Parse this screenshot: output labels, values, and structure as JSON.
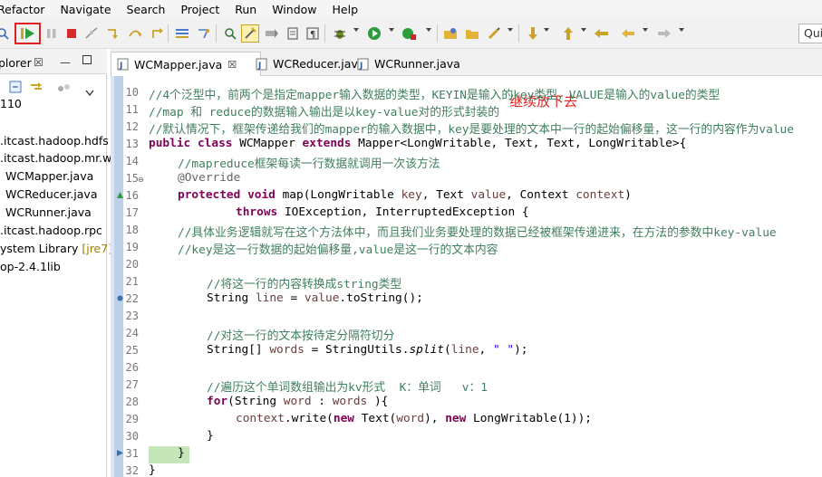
{
  "menubar": [
    "Refactor",
    "Navigate",
    "Search",
    "Project",
    "Run",
    "Window",
    "Help"
  ],
  "toolbar": {
    "icons": [
      "link-icon",
      "resume-icon",
      "suspend-icon",
      "terminate-icon",
      "disconnect-icon",
      "step-into-icon",
      "step-over-icon",
      "step-return-icon",
      "drop-to-frame-icon",
      "use-step-filters-icon",
      "new-icon",
      "pin-icon",
      "highlight-icon",
      "toggle-icon",
      "block-icon",
      "paragraph-icon",
      "debug-icon",
      "run-icon",
      "external-tools-icon",
      "open-type-icon",
      "open-folder-icon",
      "edit-icon",
      "annotation-next-icon",
      "annotation-prev-icon",
      "last-edit-icon",
      "back-icon",
      "forward-icon"
    ],
    "quick_access": "Quic"
  },
  "hint": "继续放下去",
  "explorer": {
    "tab_label": "plorer",
    "tab_close": "☒",
    "tree": [
      {
        "text": "110"
      },
      {
        "text": ".itcast.hadoop.hdfs"
      },
      {
        "text": ".itcast.hadoop.mr.w"
      },
      {
        "text": "WCMapper.java"
      },
      {
        "text": "WCReducer.java"
      },
      {
        "text": "WCRunner.java"
      },
      {
        "text": ".itcast.hadoop.rpc"
      },
      {
        "text": "ystem Library ",
        "meta": "[jre7]"
      },
      {
        "text": "op-2.4.1lib"
      }
    ]
  },
  "editor": {
    "tabs": [
      {
        "label": "WCMapper.java",
        "close": "☒"
      },
      {
        "label": "WCReducer.java"
      },
      {
        "label": "WCRunner.java"
      }
    ],
    "lines": [
      {
        "n": "10"
      },
      {
        "n": "11"
      },
      {
        "n": "12"
      },
      {
        "n": "13"
      },
      {
        "n": "14"
      },
      {
        "n": "15"
      },
      {
        "n": "16"
      },
      {
        "n": "17"
      },
      {
        "n": "18"
      },
      {
        "n": "19"
      },
      {
        "n": "20"
      },
      {
        "n": "21"
      },
      {
        "n": "22"
      },
      {
        "n": "23"
      },
      {
        "n": "24"
      },
      {
        "n": "25"
      },
      {
        "n": "26"
      },
      {
        "n": "27"
      },
      {
        "n": "28"
      },
      {
        "n": "29"
      },
      {
        "n": "30"
      },
      {
        "n": "31"
      },
      {
        "n": "32"
      }
    ],
    "code": {
      "l10": "//4个泛型中，前两个是指定mapper输入数据的类型，KEYIN是输入的key类型，VALUE是输入的value的类型",
      "l11": "//map 和 reduce的数据输入输出是以key-value对的形式封装的",
      "l12": "//默认情况下，框架传递给我们的mapper的输入数据中，key是要处理的文本中一行的起始偏移量，这一行的内容作为value",
      "l13_kw1": "public",
      "l13_kw2": "class",
      "l13_kw3": "extends",
      "l13_name": " WCMapper ",
      "l13_rest": " Mapper<LongWritable, Text, Text, LongWritable>{",
      "l14": "//mapreduce框架每读一行数据就调用一次该方法",
      "l15": "@Override",
      "l16_kw1": "protected",
      "l16_kw2": "void",
      "l16_a": " map(LongWritable ",
      "l16_p1": "key",
      "l16_b": ", Text ",
      "l16_p2": "value",
      "l16_c": ", Context ",
      "l16_p3": "context",
      "l16_d": ")",
      "l17_kw": "throws",
      "l17_rest": " IOException, InterruptedException {",
      "l18": "//具体业务逻辑就写在这个方法体中，而且我们业务要处理的数据已经被框架传递进来，在方法的参数中key-value",
      "l19": "//key是这一行数据的起始偏移量,value是这一行的文本内容",
      "l21": "//将这一行的内容转换成string类型",
      "l22_a": "String ",
      "l22_v": "line",
      "l22_b": " = ",
      "l22_p": "value",
      "l22_c": ".toString();",
      "l24": "//对这一行的文本按待定分隔符切分",
      "l25_a": "String[] ",
      "l25_v": "words",
      "l25_b": " = StringUtils.",
      "l25_m": "split",
      "l25_c": "(",
      "l25_v2": "line",
      "l25_d": ", ",
      "l25_s": "\" \"",
      "l25_e": ");",
      "l27": "//遍历这个单词数组输出为kv形式  K：单词   v：1",
      "l28_kw": "for",
      "l28_a": "(String ",
      "l28_v": "word",
      "l28_b": " : ",
      "l28_v2": "words",
      "l28_c": " ){",
      "l29_p": "context",
      "l29_a": ".write(",
      "l29_kw1": "new",
      "l29_b": " Text(",
      "l29_v": "word",
      "l29_c": "), ",
      "l29_kw2": "new",
      "l29_d": " LongWritable(1));",
      "l30": "}",
      "l31": "}",
      "l32": "}"
    }
  }
}
